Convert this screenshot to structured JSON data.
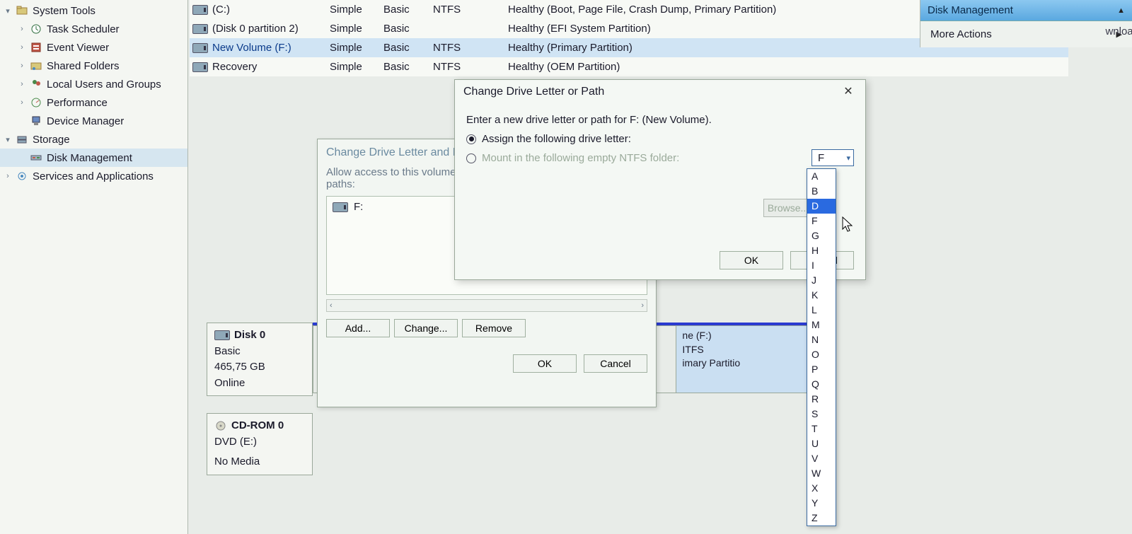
{
  "tree": {
    "system_tools": "System Tools",
    "task_scheduler": "Task Scheduler",
    "event_viewer": "Event Viewer",
    "shared_folders": "Shared Folders",
    "local_users": "Local Users and Groups",
    "performance": "Performance",
    "device_manager": "Device Manager",
    "storage": "Storage",
    "disk_management": "Disk Management",
    "services": "Services and Applications"
  },
  "volumes": {
    "cols": {
      "simple": "Simple",
      "basic": "Basic",
      "ntfs": "NTFS"
    },
    "rows": [
      {
        "name": "(C:)",
        "simple": "Simple",
        "basic": "Basic",
        "fs": "NTFS",
        "status": "Healthy (Boot, Page File, Crash Dump, Primary Partition)"
      },
      {
        "name": "(Disk 0 partition 2)",
        "simple": "Simple",
        "basic": "Basic",
        "fs": "",
        "status": "Healthy (EFI System Partition)"
      },
      {
        "name": "New Volume (F:)",
        "simple": "Simple",
        "basic": "Basic",
        "fs": "NTFS",
        "status": "Healthy (Primary Partition)"
      },
      {
        "name": "Recovery",
        "simple": "Simple",
        "basic": "Basic",
        "fs": "NTFS",
        "status": "Healthy (OEM Partition)"
      }
    ]
  },
  "actions": {
    "title": "Disk Management",
    "more": "More Actions"
  },
  "dlg1": {
    "title": "Change Drive Letter and Paths for F: (New Volume)",
    "sub": "Allow access to this volume by using the following drive letter and paths:",
    "item": "F:",
    "add": "Add...",
    "change": "Change...",
    "remove": "Remove",
    "ok": "OK",
    "cancel": "Cancel"
  },
  "dlg2": {
    "title": "Change Drive Letter or Path",
    "prompt": "Enter a new drive letter or path for F: (New Volume).",
    "opt_assign": "Assign the following drive letter:",
    "opt_mount": "Mount in the following empty NTFS folder:",
    "combo_value": "F",
    "browse": "Browse...",
    "ok": "OK",
    "cancel": "Cancel"
  },
  "drive_letters": [
    "A",
    "B",
    "D",
    "F",
    "G",
    "H",
    "I",
    "J",
    "K",
    "L",
    "M",
    "N",
    "O",
    "P",
    "Q",
    "R",
    "S",
    "T",
    "U",
    "V",
    "W",
    "X",
    "Y",
    "Z"
  ],
  "drive_letter_highlight": "D",
  "disks": {
    "d0": {
      "name": "Disk 0",
      "type": "Basic",
      "size": "465,75 GB",
      "state": "Online"
    },
    "cd": {
      "name": "CD-ROM 0",
      "type": "DVD (E:)",
      "state": "No Media"
    }
  },
  "seg_f": {
    "l1": "ne (F:)",
    "l2": "ITFS",
    "l3": "imary Partitio"
  },
  "far_right": "wnload"
}
